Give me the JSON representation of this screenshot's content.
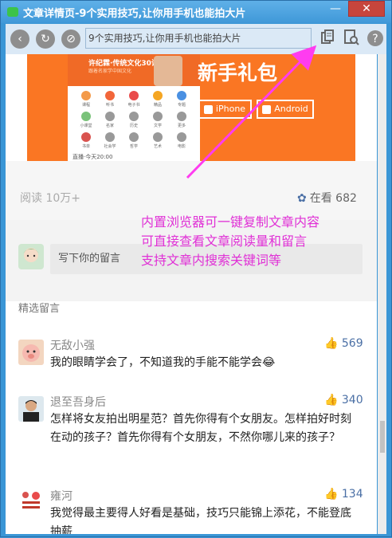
{
  "window": {
    "title": "文章详情页-9个实用技巧,让你用手机也能拍大片",
    "min_label": "—",
    "close_label": "✕"
  },
  "toolbar": {
    "back_label": "‹",
    "refresh_label": "↻",
    "clip_label": "⊘",
    "address": "9个实用技巧,让你用手机也能拍大片",
    "icons": [
      "copy-icon",
      "search-doc-icon",
      "help-icon"
    ]
  },
  "banner": {
    "app_title": "许纪霖·传统文化30讲",
    "app_sub": "跟着名家学中国文化",
    "grid_labels": [
      "课程",
      "听书",
      "电子书",
      "精品",
      "专题",
      "小课堂",
      "名家",
      "历史",
      "文学",
      "更多",
      "书单",
      "社会学",
      "哲学",
      "艺术",
      "电影"
    ],
    "footer": "直播·今天20:00",
    "gift": "新手礼包",
    "iphone": "iPhone",
    "android": "Android"
  },
  "stats": {
    "reads": "阅读 10万+",
    "watching": "在看 682"
  },
  "comment_box": {
    "placeholder": "写下你的留言"
  },
  "selected_heading": "精选留言",
  "comments": [
    {
      "name": "无敌小强",
      "likes": "569",
      "body": "我的眼睛学会了，不知道我的手能不能学会😂"
    },
    {
      "name": "退至吾身后",
      "likes": "340",
      "body": "怎样将女友拍出明星范？首先你得有个女朋友。怎样拍好时刻在动的孩子？首先你得有个女朋友，不然你哪儿来的孩子？"
    },
    {
      "name": "雍河",
      "likes": "134",
      "body": "我觉得最主要得人好看是基础，技巧只能锦上添花，不能登底抽薪"
    }
  ],
  "annotation": {
    "line1": "内置浏览器可一键复制文章内容",
    "line2": "可直接查看文章阅读量和留言",
    "line3": "支持文章内搜索关键词等"
  },
  "colors": {
    "annotation": "#e030d6",
    "banner": "#fa7623",
    "titlebar": "#3f98d8"
  }
}
